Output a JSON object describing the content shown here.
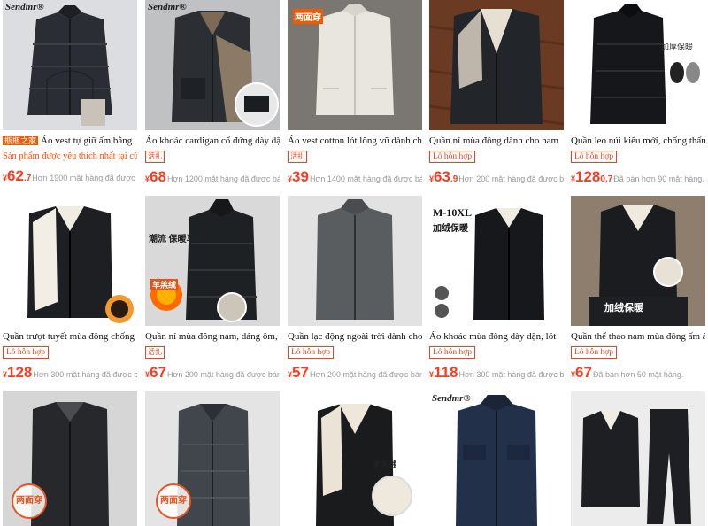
{
  "products": [
    {
      "title_tag": "瓶瓶之家",
      "title": "Áo vest tự giữ ấm bằng",
      "subline": "Sản phẩm được yêu thích nhất tại cửa hà",
      "price_int": "62",
      "price_dec": ".7",
      "sold": "Hơn 1900 mặt hàng đã được bá",
      "brand_overlay": "Sendmr®"
    },
    {
      "title": "Áo khoác cardigan cổ đứng dày dặn",
      "badge": "活扎",
      "price_int": "68",
      "sold": "Hơn 1200 mặt hàng đã được bán.",
      "brand_overlay": "Sendmr®"
    },
    {
      "title": "Áo vest cotton lót lông vũ dành cho",
      "badge": "活扎",
      "price_int": "39",
      "sold": "Hơn 1400 mặt hàng đã được bán.",
      "overlay": "两面穿"
    },
    {
      "title": "Quần nỉ mùa đông dành cho nam",
      "badge": "Lô hỗn hợp",
      "price_int": "63",
      "price_dec": ".9",
      "sold": "Hơn 200 mặt hàng đã được bán."
    },
    {
      "title": "Quần leo núi kiểu mới, chống thấm",
      "badge": "Lô hỗn hợp",
      "price_int": "128",
      "price_dec": "0,7",
      "sold": "Đã bán hơn 90 mặt hàng.",
      "overlay": "加厚保暖"
    },
    {
      "title": "Quần trượt tuyết mùa đông chống",
      "badge": "Lô hỗn hợp",
      "price_int": "128",
      "sold": "Hơn 300 mặt hàng đã được bár"
    },
    {
      "title": "Quần nỉ mùa đông nam, dáng ôm, lót",
      "badge": "活扎",
      "price_int": "67",
      "sold": "Hơn 200 mặt hàng đã được bán.",
      "overlay": "潮流 保暖马甲",
      "overlay2": "羊羔绒"
    },
    {
      "title": "Quần lạc động ngoài trời dành cho",
      "badge": "Lô hỗn hợp",
      "price_int": "57",
      "sold": "Hơn 200 mặt hàng đã được bán."
    },
    {
      "title": "Áo khoác mùa đông dày dặn, lót",
      "badge": "Lô hỗn hợp",
      "price_int": "118",
      "sold": "Hơn 300 mặt hàng đã được bár",
      "overlay": "M-10XL",
      "overlay2": "加绒保暖"
    },
    {
      "title": "Quần thể thao nam mùa đông ấm áp,",
      "badge": "Lô hỗn hợp",
      "price_int": "67",
      "sold": "Đã bán hơn 50 mặt hàng.",
      "overlay": "加绒保暖"
    },
    {
      "overlay": "两面穿"
    },
    {
      "overlay": "两面穿"
    },
    {
      "overlay": "羊羔绒"
    },
    {
      "brand_overlay": "Sendmr®"
    },
    {}
  ],
  "currency_symbol": "¥",
  "colors": {
    "price": "#ff3b1f",
    "badge": "#f0401c",
    "subline": "#ff5000"
  }
}
